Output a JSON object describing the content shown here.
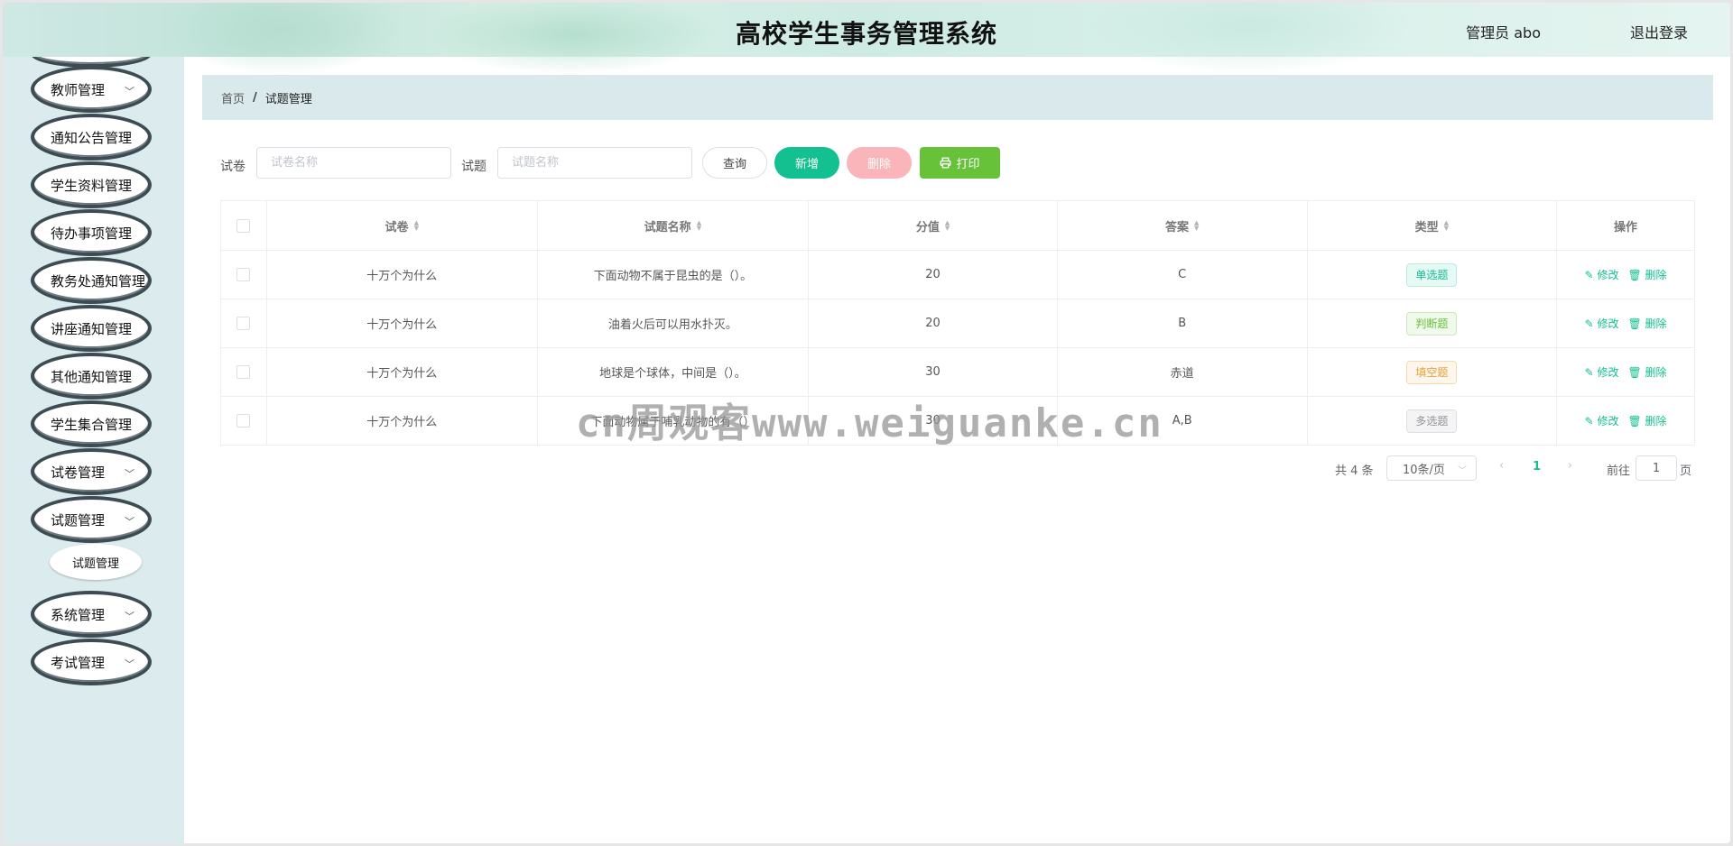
{
  "header": {
    "title": "高校学生事务管理系统",
    "user_label": "管理员 abo",
    "logout_label": "退出登录"
  },
  "sidebar": {
    "items": [
      {
        "label": "教师管理",
        "chevron": true
      },
      {
        "label": "通知公告管理",
        "chevron": false
      },
      {
        "label": "学生资料管理",
        "chevron": false
      },
      {
        "label": "待办事项管理",
        "chevron": false
      },
      {
        "label": "教务处通知管理",
        "chevron": false
      },
      {
        "label": "讲座通知管理",
        "chevron": false
      },
      {
        "label": "其他通知管理",
        "chevron": false
      },
      {
        "label": "学生集合管理",
        "chevron": false
      },
      {
        "label": "试卷管理",
        "chevron": true
      },
      {
        "label": "试题管理",
        "chevron": true
      },
      {
        "label": "系统管理",
        "chevron": true
      },
      {
        "label": "考试管理",
        "chevron": true
      }
    ],
    "subitem": "试题管理"
  },
  "breadcrumb": {
    "home": "首页",
    "separator": "/",
    "current": "试题管理"
  },
  "search": {
    "paper_label": "试卷",
    "paper_placeholder": "试卷名称",
    "question_label": "试题",
    "question_placeholder": "试题名称",
    "query_label": "查询",
    "add_label": "新增",
    "delete_label": "删除",
    "print_label": "打印"
  },
  "table": {
    "columns": [
      "试卷",
      "试题名称",
      "分值",
      "答案",
      "类型",
      "操作"
    ],
    "rows": [
      {
        "paper": "十万个为什么",
        "name": "下面动物不属于昆虫的是（）。",
        "score": "20",
        "answer": "C",
        "type": "单选题"
      },
      {
        "paper": "十万个为什么",
        "name": "油着火后可以用水扑灭。",
        "score": "20",
        "answer": "B",
        "type": "判断题"
      },
      {
        "paper": "十万个为什么",
        "name": "地球是个球体，中间是（）。",
        "score": "30",
        "answer": "赤道",
        "type": "填空题"
      },
      {
        "paper": "十万个为什么",
        "name": "下面动物属于哺乳动物的有（）",
        "score": "30",
        "answer": "A,B",
        "type": "多选题"
      }
    ],
    "edit_label": "修改",
    "remove_label": "删除"
  },
  "pagination": {
    "total": "共 4 条",
    "page_size": "10条/页",
    "current_page": "1",
    "goto_label": "前往",
    "goto_value": "1",
    "page_suffix": "页"
  },
  "watermark": "cn周观客www.weiguanke.cn",
  "colors": {
    "accent": "#13c08f",
    "sidebar_bg": "#dcebed",
    "breadcrumb_bg": "#daeaec",
    "delete_btn": "#f9b5b9",
    "print_btn": "#67c23a",
    "tag_single": "#13c08f",
    "tag_judge": "#67c23a",
    "tag_fill": "#e6a23c",
    "tag_multi": "#909399"
  }
}
